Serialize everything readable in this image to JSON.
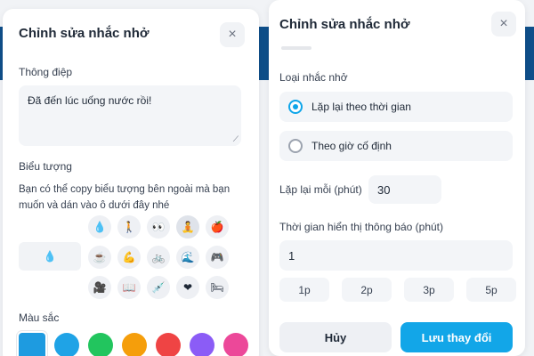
{
  "colors": {
    "accent": "#12a6e8",
    "radio_checked": "#0ea5e9"
  },
  "left_panel": {
    "title": "Chỉnh sửa nhắc nhở",
    "close_icon": "×",
    "message_label": "Thông điệp",
    "message_value": "Đã đến lúc uống nước rồi!",
    "icon_label": "Biểu tượng",
    "icon_description": "Bạn có thể copy biểu tượng bên ngoài mà bạn muốn và dán vào ô dưới đây nhé",
    "selected_icon": "💧",
    "icons": [
      "💧",
      "🚶",
      "👀",
      "🧘",
      "🍎",
      "☕",
      "💪",
      "🚲",
      "🌊",
      "🎮",
      "🎥",
      "📖",
      "💉",
      "❤",
      "🛏"
    ],
    "color_label": "Màu sắc",
    "swatches": [
      "#1e9be0",
      "#1fa3e6",
      "#22c55e",
      "#f59e0b",
      "#ef4444",
      "#8b5cf6",
      "#ec4899"
    ]
  },
  "right_panel": {
    "title": "Chỉnh sửa nhắc nhở",
    "close_icon": "×",
    "type_label": "Loại nhắc nhở",
    "option_repeat": "Lặp lại theo thời gian",
    "option_fixed": "Theo giờ cố định",
    "repeat_label": "Lặp lại mỗi (phút)",
    "repeat_value": "30",
    "display_label": "Thời gian hiển thị thông báo (phút)",
    "display_value": "1",
    "presets": [
      "1p",
      "2p",
      "3p",
      "5p"
    ],
    "cancel_label": "Hủy",
    "save_label": "Lưu thay đổi"
  }
}
